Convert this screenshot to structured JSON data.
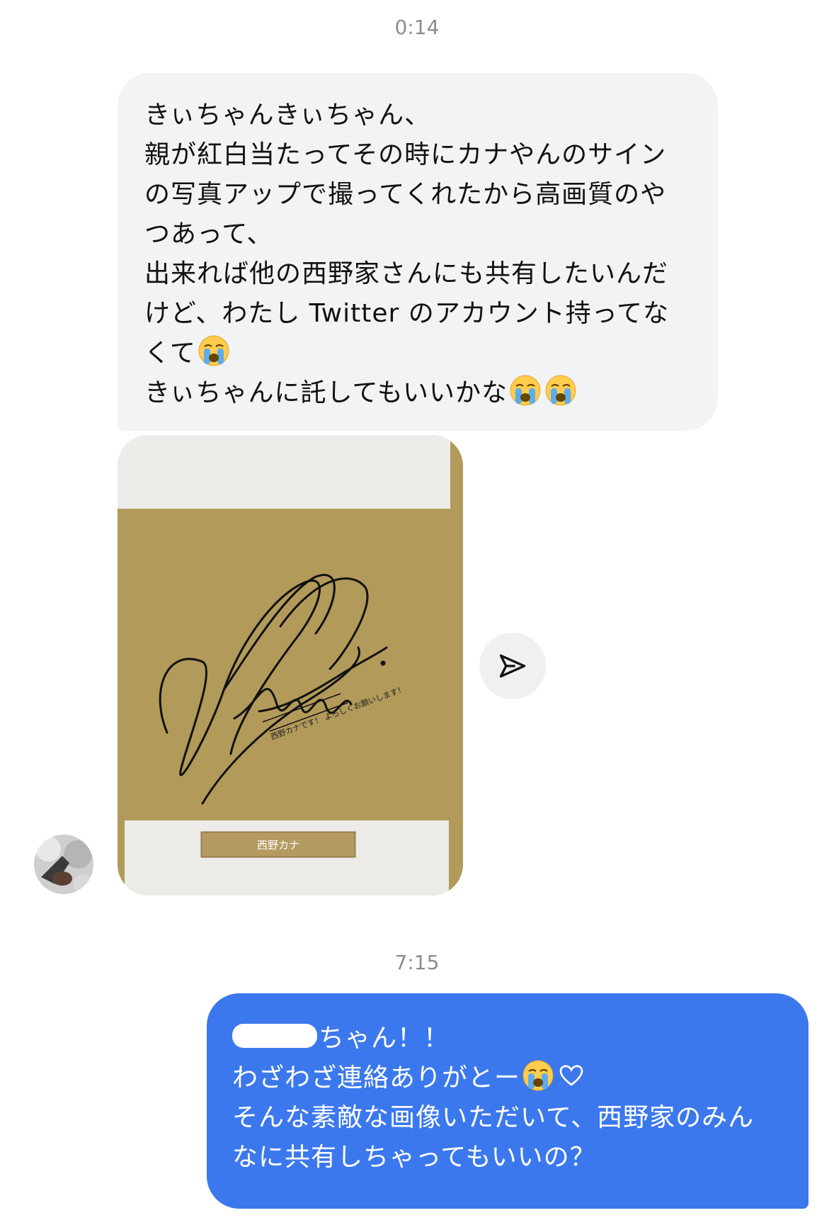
{
  "conversation": {
    "timestamp_1": "0:14",
    "incoming_message": {
      "lines": [
        "きぃちゃんきぃちゃん、",
        "親が紅白当たってその時にカナやんのサイン",
        "の写真アップで撮ってくれたから高画質のや",
        "つあって、",
        "出来れば他の西野家さんにも共有したいんだ",
        "けど、わたし Twitter のアカウント持ってな",
        "くて",
        "きぃちゃんに託してもいいかな"
      ],
      "emoji": "loudly-crying-face"
    },
    "photo": {
      "nameplate": "西野カナ",
      "handwritten_message": "西野カナです！ よろしくお願いします！"
    },
    "timestamp_2": "7:15",
    "outgoing_message": {
      "lines": [
        "ちゃん！！",
        "わざわざ連絡ありがとー",
        "そんな素敵な画像いただいて、西野家のみん",
        "なに共有しちゃってもいいの？"
      ],
      "redacted": true,
      "emoji": "loudly-crying-face",
      "trailing_symbol": "heart-outline"
    }
  },
  "colors": {
    "incoming_bubble": "#f2f3f5",
    "outgoing_bubble": "#3c78ed",
    "timestamp_text": "#8a8d91",
    "gold_board": "#b39b5a"
  },
  "icons": {
    "share": "paper-plane-icon",
    "avatar": "contact-avatar"
  }
}
